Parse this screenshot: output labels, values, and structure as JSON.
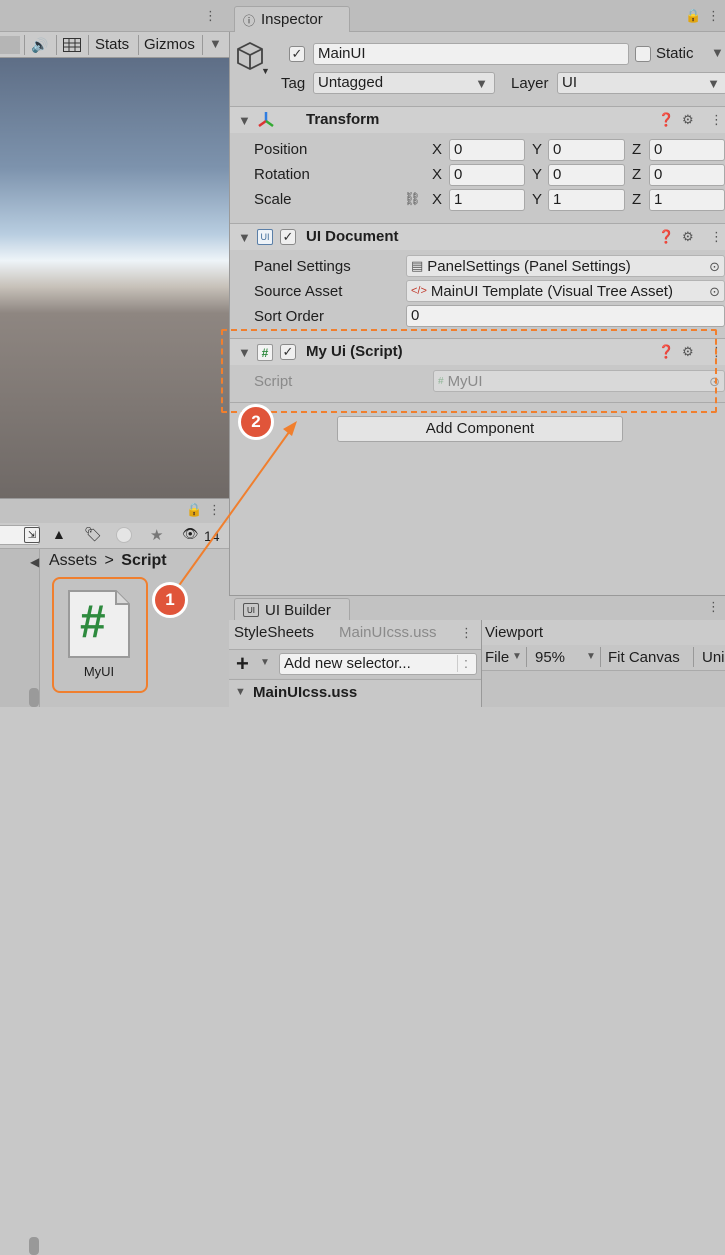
{
  "scene": {
    "toolbar": {
      "audio_icon": "speaker-icon",
      "grid_icon": "grid-icon",
      "stats_label": "Stats",
      "gizmos_label": "Gizmos"
    }
  },
  "project": {
    "hidden_count": "14",
    "breadcrumb": {
      "root": "Assets",
      "separator": ">",
      "current": "Script"
    },
    "asset": {
      "name": "MyUI",
      "glyph": "#"
    }
  },
  "inspector": {
    "tab_label": "Inspector",
    "object": {
      "name": "MainUI",
      "static_label": "Static",
      "tag_label": "Tag",
      "tag_value": "Untagged",
      "layer_label": "Layer",
      "layer_value": "UI"
    },
    "transform": {
      "title": "Transform",
      "rows": [
        {
          "label": "Position",
          "x": "0",
          "y": "0",
          "z": "0"
        },
        {
          "label": "Rotation",
          "x": "0",
          "y": "0",
          "z": "0"
        },
        {
          "label": "Scale",
          "x": "1",
          "y": "1",
          "z": "1"
        }
      ],
      "axis_x": "X",
      "axis_y": "Y",
      "axis_z": "Z"
    },
    "ui_document": {
      "title": "UI Document",
      "panel_settings_label": "Panel Settings",
      "panel_settings_value": "PanelSettings (Panel Settings)",
      "source_asset_label": "Source Asset",
      "source_asset_value": "MainUI Template (Visual Tree Asset)",
      "sort_order_label": "Sort Order",
      "sort_order_value": "0"
    },
    "script_component": {
      "title": "My Ui (Script)",
      "script_label": "Script",
      "script_value": "MyUI"
    },
    "add_component_label": "Add Component"
  },
  "ui_builder": {
    "tab_label": "UI Builder",
    "stylesheets_label": "StyleSheets",
    "stylesheet_file": "MainUIcss.uss",
    "add_selector_placeholder": "Add new selector...",
    "add_selector_hint": ":",
    "stylesheet_item": "MainUIcss.uss",
    "viewport_label": "Viewport",
    "file_menu": "File",
    "zoom": "95%",
    "fit_canvas": "Fit Canvas",
    "unity_default": "Uni"
  },
  "annotations": {
    "step1": "1",
    "step2": "2",
    "accent": "#f07f2e",
    "badge_color": "#e0553a"
  }
}
